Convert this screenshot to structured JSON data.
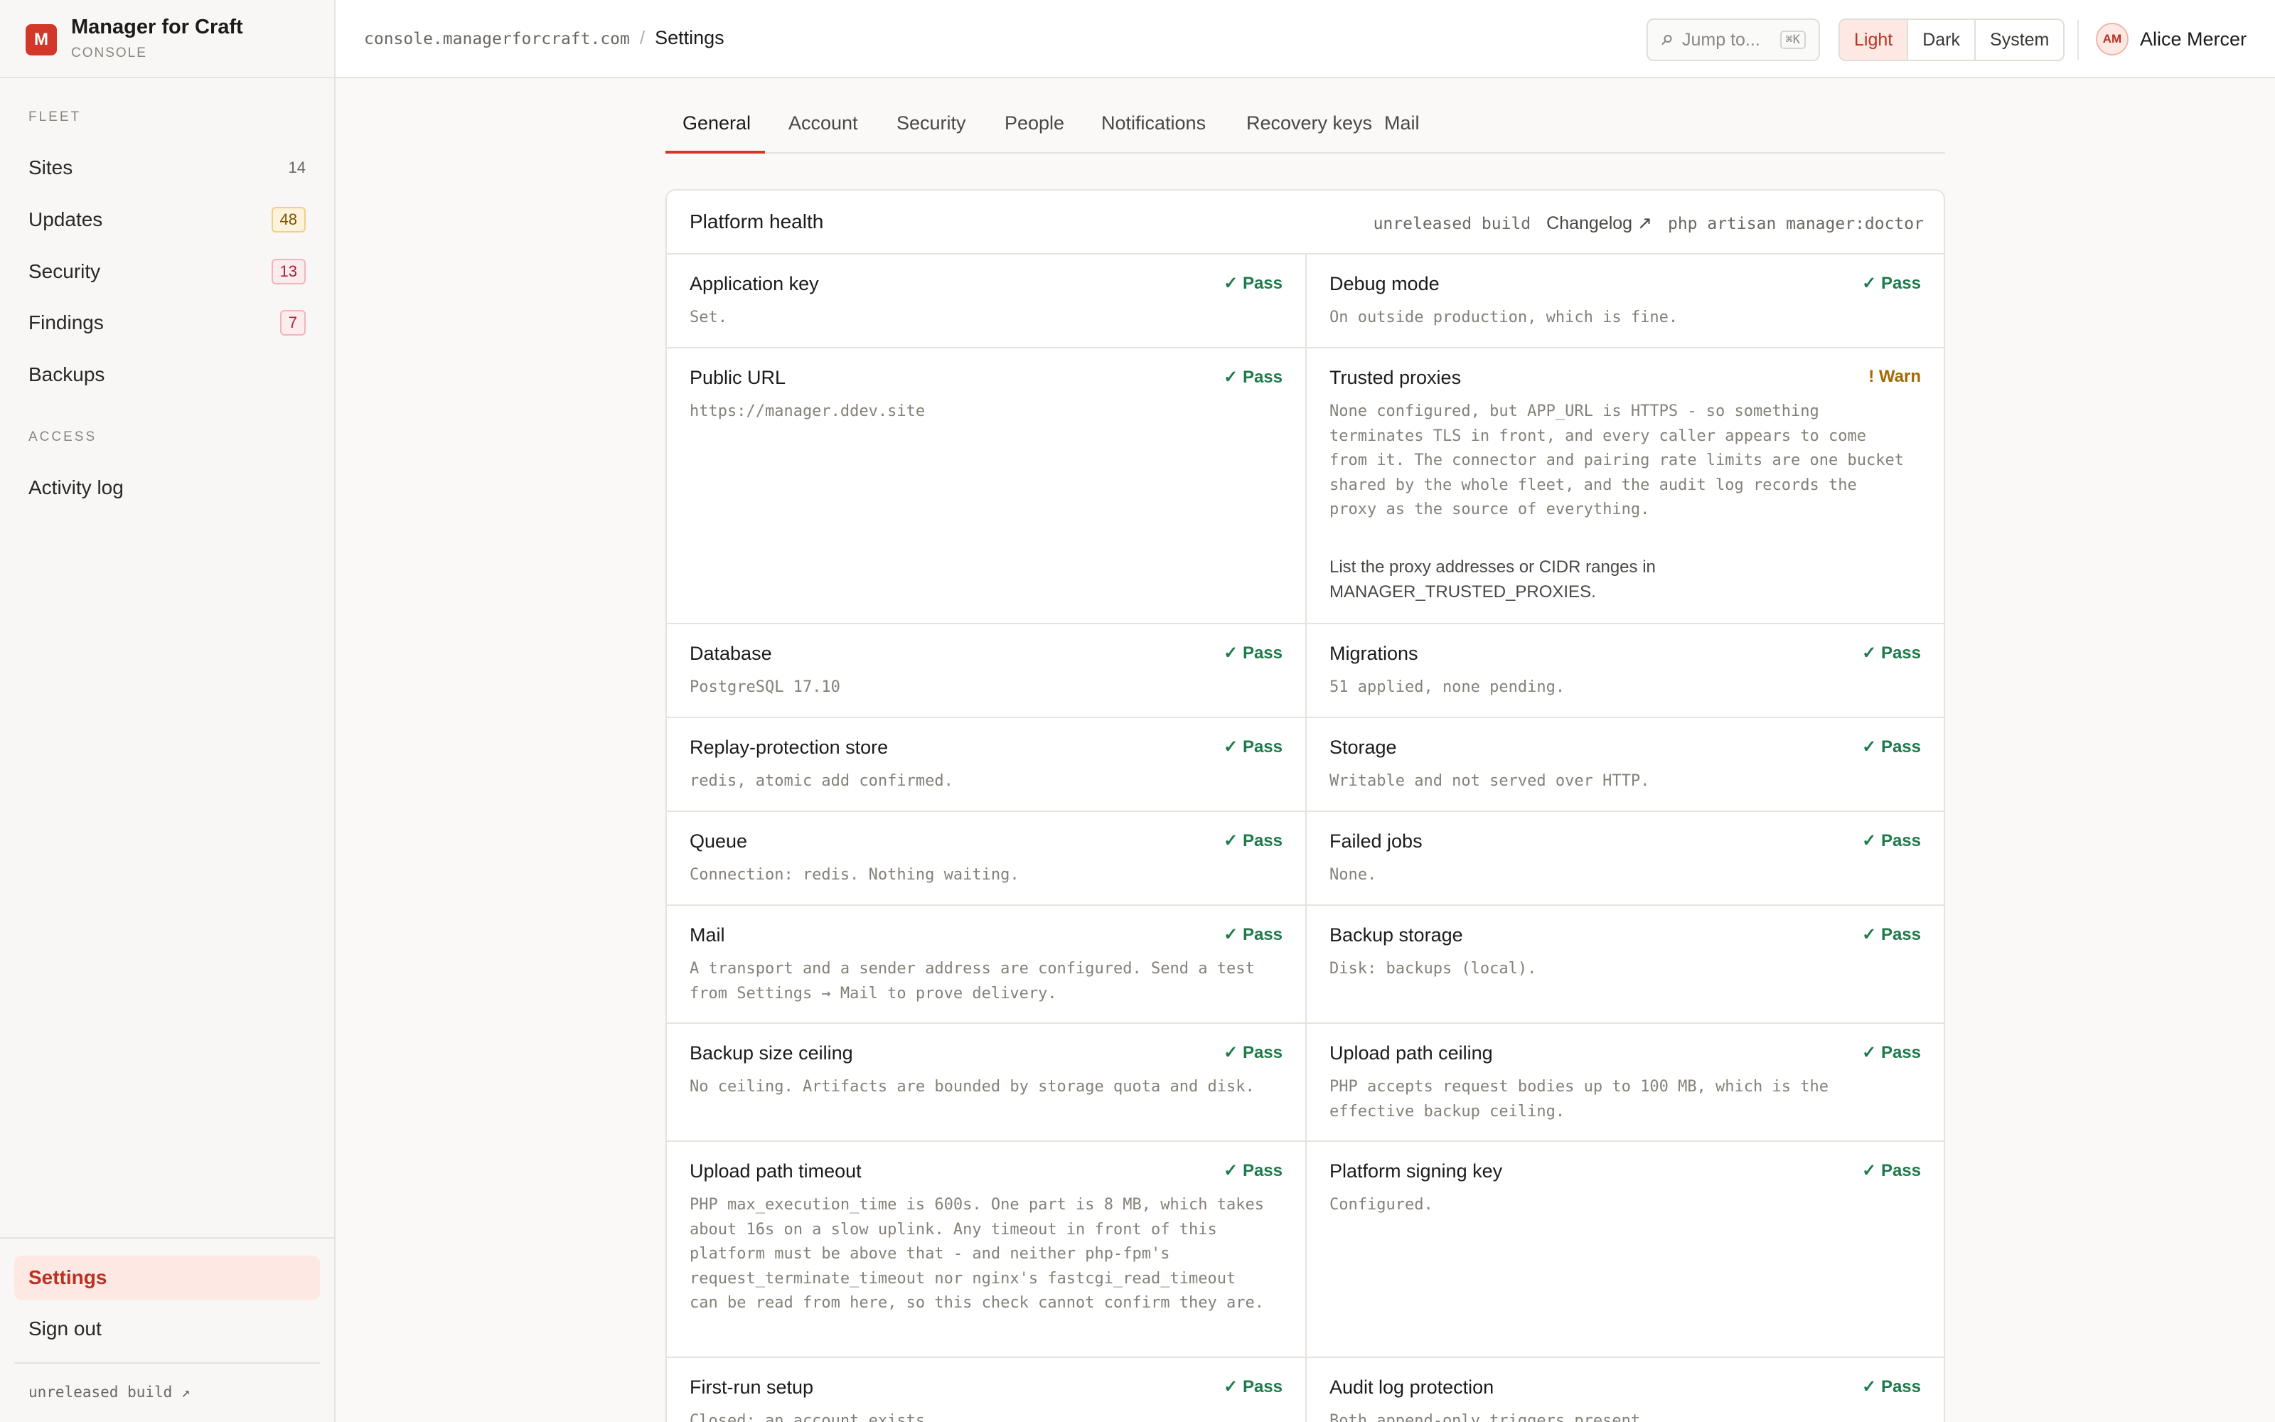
{
  "app": {
    "logo_letter": "M",
    "name": "Manager for Craft",
    "subtitle": "CONSOLE"
  },
  "sidebar": {
    "groups": [
      {
        "label": "FLEET"
      },
      {
        "label": "ACCESS"
      }
    ],
    "items": [
      {
        "label": "Sites",
        "count": "14"
      },
      {
        "label": "Updates",
        "count": "48"
      },
      {
        "label": "Security",
        "count": "13"
      },
      {
        "label": "Findings",
        "count": "7"
      },
      {
        "label": "Backups"
      },
      {
        "label": "Activity log"
      }
    ],
    "bottom": [
      {
        "label": "Settings",
        "active": true
      },
      {
        "label": "Sign out"
      }
    ],
    "footer": "unreleased build ↗"
  },
  "header": {
    "host": "console.managerforcraft.com",
    "separator": "/",
    "page": "Settings",
    "jump_placeholder": "Jump to...",
    "jump_shortcut": "⌘K",
    "theme_options": [
      "Light",
      "Dark",
      "System"
    ],
    "theme_selected": "Light",
    "user": {
      "initials": "AM",
      "name": "Alice Mercer"
    }
  },
  "tabs": [
    "General",
    "Account",
    "Security",
    "People",
    "Notifications",
    "Recovery keys",
    "Mail"
  ],
  "active_tab": "General",
  "health": {
    "title": "Platform health",
    "build": "unreleased build",
    "changelog": "Changelog ↗",
    "command": "php artisan manager:doctor",
    "checks": [
      {
        "title": "Application key",
        "status": "✓ Pass",
        "detail": "Set."
      },
      {
        "title": "Debug mode",
        "status": "✓ Pass",
        "detail": "On outside production, which is fine."
      },
      {
        "title": "Public URL",
        "status": "✓ Pass",
        "detail": "https://manager.ddev.site"
      },
      {
        "title": "Trusted proxies",
        "status": "! Warn",
        "detail": "None configured, but APP_URL is HTTPS - so something terminates TLS in front, and every caller appears to come from it. The connector and pairing rate limits are one bucket shared by the whole fleet, and the audit log records the proxy as the source of everything.",
        "note": "List the proxy addresses or CIDR ranges in MANAGER_TRUSTED_PROXIES."
      },
      {
        "title": "Database",
        "status": "✓ Pass",
        "detail": "PostgreSQL 17.10"
      },
      {
        "title": "Migrations",
        "status": "✓ Pass",
        "detail": "51 applied, none pending."
      },
      {
        "title": "Replay-protection store",
        "status": "✓ Pass",
        "detail": "redis, atomic add confirmed."
      },
      {
        "title": "Storage",
        "status": "✓ Pass",
        "detail": "Writable and not served over HTTP."
      },
      {
        "title": "Queue",
        "status": "✓ Pass",
        "detail": "Connection: redis. Nothing waiting."
      },
      {
        "title": "Failed jobs",
        "status": "✓ Pass",
        "detail": "None."
      },
      {
        "title": "Mail",
        "status": "✓ Pass",
        "detail": "A transport and a sender address are configured. Send a test from Settings → Mail to prove delivery."
      },
      {
        "title": "Backup storage",
        "status": "✓ Pass",
        "detail": "Disk: backups (local)."
      },
      {
        "title": "Backup size ceiling",
        "status": "✓ Pass",
        "detail": "No ceiling. Artifacts are bounded by storage quota and disk."
      },
      {
        "title": "Upload path ceiling",
        "status": "✓ Pass",
        "detail": "PHP accepts request bodies up to 100 MB, which is the effective backup ceiling."
      },
      {
        "title": "Upload path timeout",
        "status": "✓ Pass",
        "detail": "PHP max_execution_time is 600s. One part is 8 MB, which takes about 16s on a slow uplink. Any timeout in front of this platform must be above that - and neither php-fpm's request_terminate_timeout nor nginx's fastcgi_read_timeout can be read from here, so this check cannot confirm they are."
      },
      {
        "title": "Platform signing key",
        "status": "✓ Pass",
        "detail": "Configured."
      },
      {
        "title": "First-run setup",
        "status": "✓ Pass",
        "detail": "Closed; an account exists."
      },
      {
        "title": "Audit log protection",
        "status": "✓ Pass",
        "detail": "Both append-only triggers present."
      }
    ]
  },
  "colors": {
    "accent": "#d2382a",
    "pass": "#1d7a4a",
    "warn": "#a36a00"
  }
}
